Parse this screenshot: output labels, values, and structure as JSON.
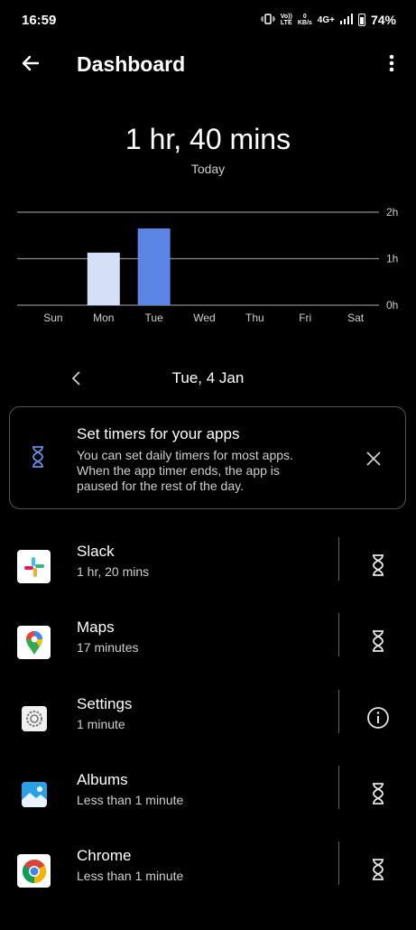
{
  "status_bar": {
    "time": "16:59",
    "volte_top": "Vo))",
    "volte_bottom": "LTE",
    "speed_top": "0",
    "speed_bottom": "KB/s",
    "network": "4G+",
    "battery": "74%"
  },
  "header": {
    "title": "Dashboard",
    "back_icon": "arrow-left-icon",
    "menu_icon": "more-vertical-icon"
  },
  "summary": {
    "total": "1 hr, 40 mins",
    "period": "Today"
  },
  "chart_data": {
    "type": "bar",
    "categories": [
      "Sun",
      "Mon",
      "Tue",
      "Wed",
      "Thu",
      "Fri",
      "Sat"
    ],
    "values": [
      0,
      1.13,
      1.65,
      0,
      0,
      0,
      0
    ],
    "y_tick_labels": [
      "0h",
      "1h",
      "2h"
    ],
    "ylim": [
      0,
      2
    ],
    "selected": "Tue",
    "colors": {
      "default": "#d6dff8",
      "selected": "#5b86e5",
      "grid": "#8a8a8a"
    }
  },
  "date_nav": {
    "prev_icon": "chevron-left-icon",
    "date": "Tue, 4 Jan"
  },
  "timer_card": {
    "icon": "hourglass-icon",
    "title": "Set timers for your apps",
    "body": "You can set daily timers for most apps. When the app timer ends, the app is paused for the rest of the day.",
    "close_icon": "close-icon"
  },
  "apps": [
    {
      "name": "Slack",
      "time": "1 hr, 20 mins",
      "icon": "slack-icon",
      "action": "hourglass-icon"
    },
    {
      "name": "Maps",
      "time": "17 minutes",
      "icon": "maps-icon",
      "action": "hourglass-icon"
    },
    {
      "name": "Settings",
      "time": "1 minute",
      "icon": "settings-icon",
      "action": "info-icon"
    },
    {
      "name": "Albums",
      "time": "Less than 1 minute",
      "icon": "albums-icon",
      "action": "hourglass-icon"
    },
    {
      "name": "Chrome",
      "time": "Less than 1 minute",
      "icon": "chrome-icon",
      "action": "hourglass-icon"
    }
  ]
}
